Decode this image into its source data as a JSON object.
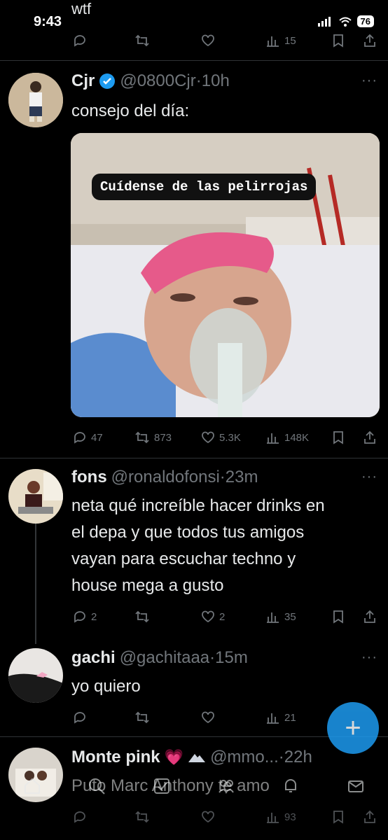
{
  "status": {
    "time": "9:43",
    "battery": "76"
  },
  "tweet0": {
    "text": "wtf",
    "views": "15"
  },
  "tweet1": {
    "name": "Cjr",
    "handle": "@0800Cjr",
    "time": "·10h",
    "text": "consejo del día:",
    "image_caption": "Cuídense de las pelirrojas",
    "replies": "47",
    "retweets": "873",
    "likes": "5.3K",
    "views": "148K"
  },
  "tweet2": {
    "name": "fons",
    "handle": "@ronaldofonsi",
    "time": "·23m",
    "text_lines": [
      "neta qué increíble hacer drinks en",
      "el depa y que todos tus amigos",
      "vayan para escuchar techno y",
      "house mega a gusto"
    ],
    "replies": "2",
    "likes": "2",
    "views": "35"
  },
  "tweet3": {
    "name": "gachi",
    "handle": "@gachitaaa",
    "time": "·15m",
    "text": "yo quiero",
    "views": "21"
  },
  "tweet4": {
    "name": "Monte pink",
    "handle": "@mmo...",
    "time": "·22h",
    "text": "Puto Marc Anthony te amo",
    "views": "93"
  },
  "colors": {
    "accent": "#1d9bf0",
    "background": "#000000",
    "muted": "#71767b",
    "text": "#e7e9ea"
  }
}
